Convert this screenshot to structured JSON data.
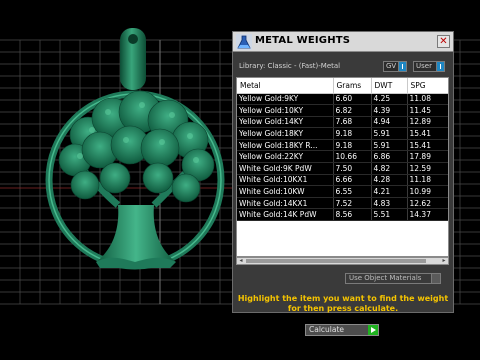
{
  "panel": {
    "title": "METAL WEIGHTS",
    "close_label": "✕",
    "library_label": "Library: Classic - (Fast)-Metal",
    "toggles": {
      "gv_label": "GV",
      "user_label": "User"
    },
    "table": {
      "headers": [
        "Metal",
        "Grams",
        "DWT",
        "SPG"
      ],
      "rows": [
        [
          "Yellow Gold:9KY",
          "6.60",
          "4.25",
          "11.08"
        ],
        [
          "Yellow Gold:10KY",
          "6.82",
          "4.39",
          "11.45"
        ],
        [
          "Yellow Gold:14KY",
          "7.68",
          "4.94",
          "12.89"
        ],
        [
          "Yellow Gold:18KY",
          "9.18",
          "5.91",
          "15.41"
        ],
        [
          "Yellow Gold:18KY R...",
          "9.18",
          "5.91",
          "15.41"
        ],
        [
          "Yellow Gold:22KY",
          "10.66",
          "6.86",
          "17.89"
        ],
        [
          "White Gold:9K PdW",
          "7.50",
          "4.82",
          "12.59"
        ],
        [
          "White Gold:10KX1",
          "6.66",
          "4.28",
          "11.18"
        ],
        [
          "White Gold:10KW",
          "6.55",
          "4.21",
          "10.99"
        ],
        [
          "White Gold:14KX1",
          "7.52",
          "4.83",
          "12.62"
        ],
        [
          "White Gold:14K PdW",
          "8.56",
          "5.51",
          "14.37"
        ]
      ]
    },
    "use_object_materials_label": "Use Object Materials",
    "hint_line1": "Highlight the item you want to find the weight",
    "hint_line2": "for then press calculate.",
    "calculate_label": "Calculate"
  },
  "colors": {
    "model_green": "#1f7a5a",
    "grid_line": "#5a5a5a",
    "hint_yellow": "#f5c400",
    "accent_blue": "#1e86c2",
    "go_green": "#1fb21f"
  },
  "icons": {
    "app": "flask-icon",
    "close": "close-icon",
    "toggle": "toggle-switch-icon",
    "calculate": "play-arrow-icon"
  }
}
